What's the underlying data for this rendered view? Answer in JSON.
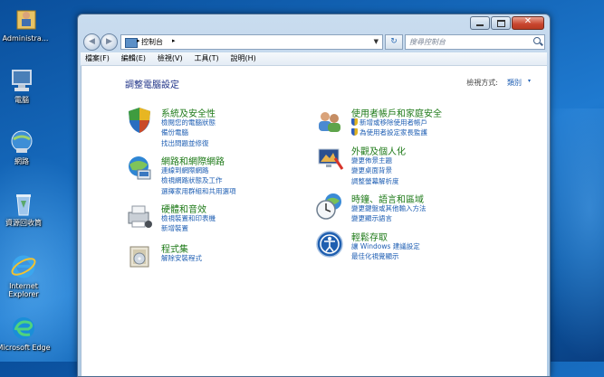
{
  "desktop": {
    "icons": [
      {
        "label": "Administra...",
        "icon": "user-folder-icon"
      },
      {
        "label": "電腦",
        "icon": "computer-icon"
      },
      {
        "label": "網路",
        "icon": "network-icon"
      },
      {
        "label": "資源回收筒",
        "icon": "recycle-bin-icon"
      },
      {
        "label": "Internet Explorer",
        "icon": "internet-explorer-icon"
      },
      {
        "label": "Microsoft Edge",
        "icon": "edge-icon"
      }
    ]
  },
  "window": {
    "address": {
      "crumb": "控制台",
      "separator": "▸"
    },
    "search": {
      "placeholder": "搜尋控制台"
    },
    "menu": [
      "檔案(F)",
      "編輯(E)",
      "檢視(V)",
      "工具(T)",
      "說明(H)"
    ],
    "page_title": "調整電腦設定",
    "view_by": {
      "label": "檢視方式:",
      "value": "類別",
      "arrow": "▾"
    },
    "categories": [
      {
        "title": "系統及安全性",
        "icon": "system-security-icon",
        "links": [
          {
            "text": "檢閱您的電腦狀態",
            "shield": false
          },
          {
            "text": "備份電腦",
            "shield": false
          },
          {
            "text": "找出問題並修復",
            "shield": false
          }
        ]
      },
      {
        "title": "網路和網際網路",
        "icon": "network-internet-icon",
        "links": [
          {
            "text": "連線到網際網路",
            "shield": false
          },
          {
            "text": "檢視網路狀態及工作",
            "shield": false
          },
          {
            "text": "選擇家用群組和共用選項",
            "shield": false
          }
        ]
      },
      {
        "title": "硬體和音效",
        "icon": "hardware-sound-icon",
        "links": [
          {
            "text": "檢視裝置和印表機",
            "shield": false
          },
          {
            "text": "新增裝置",
            "shield": false
          }
        ]
      },
      {
        "title": "程式集",
        "icon": "programs-icon",
        "links": [
          {
            "text": "解除安裝程式",
            "shield": false
          }
        ]
      },
      {
        "title": "使用者帳戶和家庭安全",
        "icon": "user-accounts-icon",
        "links": [
          {
            "text": "新增或移除使用者帳戶",
            "shield": true
          },
          {
            "text": "為使用者設定家長監護",
            "shield": true
          }
        ]
      },
      {
        "title": "外觀及個人化",
        "icon": "appearance-icon",
        "links": [
          {
            "text": "變更佈景主題",
            "shield": false
          },
          {
            "text": "變更桌面背景",
            "shield": false
          },
          {
            "text": "調整螢幕解析度",
            "shield": false
          }
        ]
      },
      {
        "title": "時鐘、語言和區域",
        "icon": "clock-language-icon",
        "links": [
          {
            "text": "變更鍵盤或其他輸入方法",
            "shield": false
          },
          {
            "text": "變更顯示語言",
            "shield": false
          }
        ]
      },
      {
        "title": "輕鬆存取",
        "icon": "ease-of-access-icon",
        "links": [
          {
            "text": "讓 Windows 建議設定",
            "shield": false
          },
          {
            "text": "最佳化視覺顯示",
            "shield": false
          }
        ]
      }
    ]
  }
}
